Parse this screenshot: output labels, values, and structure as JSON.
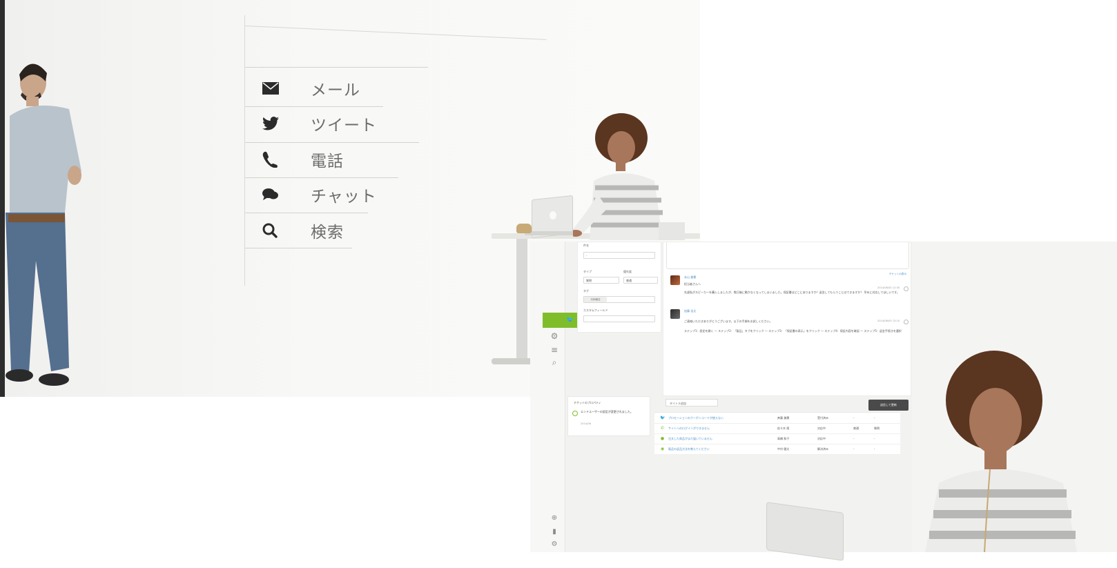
{
  "left_panel": {
    "menu": [
      {
        "icon": "mail-icon",
        "label": "メール"
      },
      {
        "icon": "twitter-icon",
        "label": "ツイート"
      },
      {
        "icon": "phone-icon",
        "label": "電話"
      },
      {
        "icon": "chat-icon",
        "label": "チャット"
      },
      {
        "icon": "search-icon",
        "label": "検索"
      }
    ]
  },
  "app": {
    "form": {
      "field1_label": "件名",
      "select1_value": "-",
      "type_label": "タイプ",
      "type_value": "質問",
      "priority_label": "優先度",
      "priority_value": "普通",
      "tags_label": "タグ",
      "tag_chip": "月例報告",
      "custom_label": "カスタムフィールド"
    },
    "thread": {
      "ticket_link": "チケットの表示",
      "messages": [
        {
          "author": "永山 美穂",
          "greeting": "担当者さんへ",
          "body": "先週私がスピーカーを購入しましたが、数日後に動かなくなってしまいました。保証書はどこにありますか？返金してもらうことはできますか？ 早めに対応してほしいです。",
          "time": "2014/06/05 12:30"
        },
        {
          "author": "加藤 浩太",
          "greeting": "ご連絡いただきありがとうございます。以下の手順をお試しください。",
          "body": "ステップ1：設定を開く — ステップ2：「製品」タブをクリック — ステップ3：「保証書の表示」をクリック — ステップ4：保証内容を確認 — ステップ5：返金手続きを選択",
          "time": "2014/06/05 13:10"
        }
      ]
    },
    "toolbar": {
      "left_label": "タイトル追加",
      "submit_label": "送信して更新"
    },
    "side_list": {
      "header": "チケットのプロパティ",
      "text": "エンドユーザーの設定が変更されました。",
      "date": "2014/06"
    },
    "tickets": [
      {
        "icon": "twitter-icon",
        "subject": "プロモーションのクーポンコードが使えない",
        "requester": "斉藤 美穂",
        "status": "受付済み",
        "priority": "-",
        "type": "-"
      },
      {
        "icon": "phone-icon",
        "subject": "サイトへのログインができません",
        "requester": "佐々木 翔",
        "status": "対応中",
        "priority": "普通",
        "type": "質問"
      },
      {
        "icon": "chat-icon",
        "subject": "注文した商品がまだ届いていません",
        "requester": "高橋 和子",
        "status": "対応中",
        "priority": "-",
        "type": "-"
      },
      {
        "icon": "check-circle-icon",
        "subject": "製品の返品方法を教えてください",
        "requester": "中村 健太",
        "status": "解決済み",
        "priority": "-",
        "type": "-"
      }
    ]
  }
}
